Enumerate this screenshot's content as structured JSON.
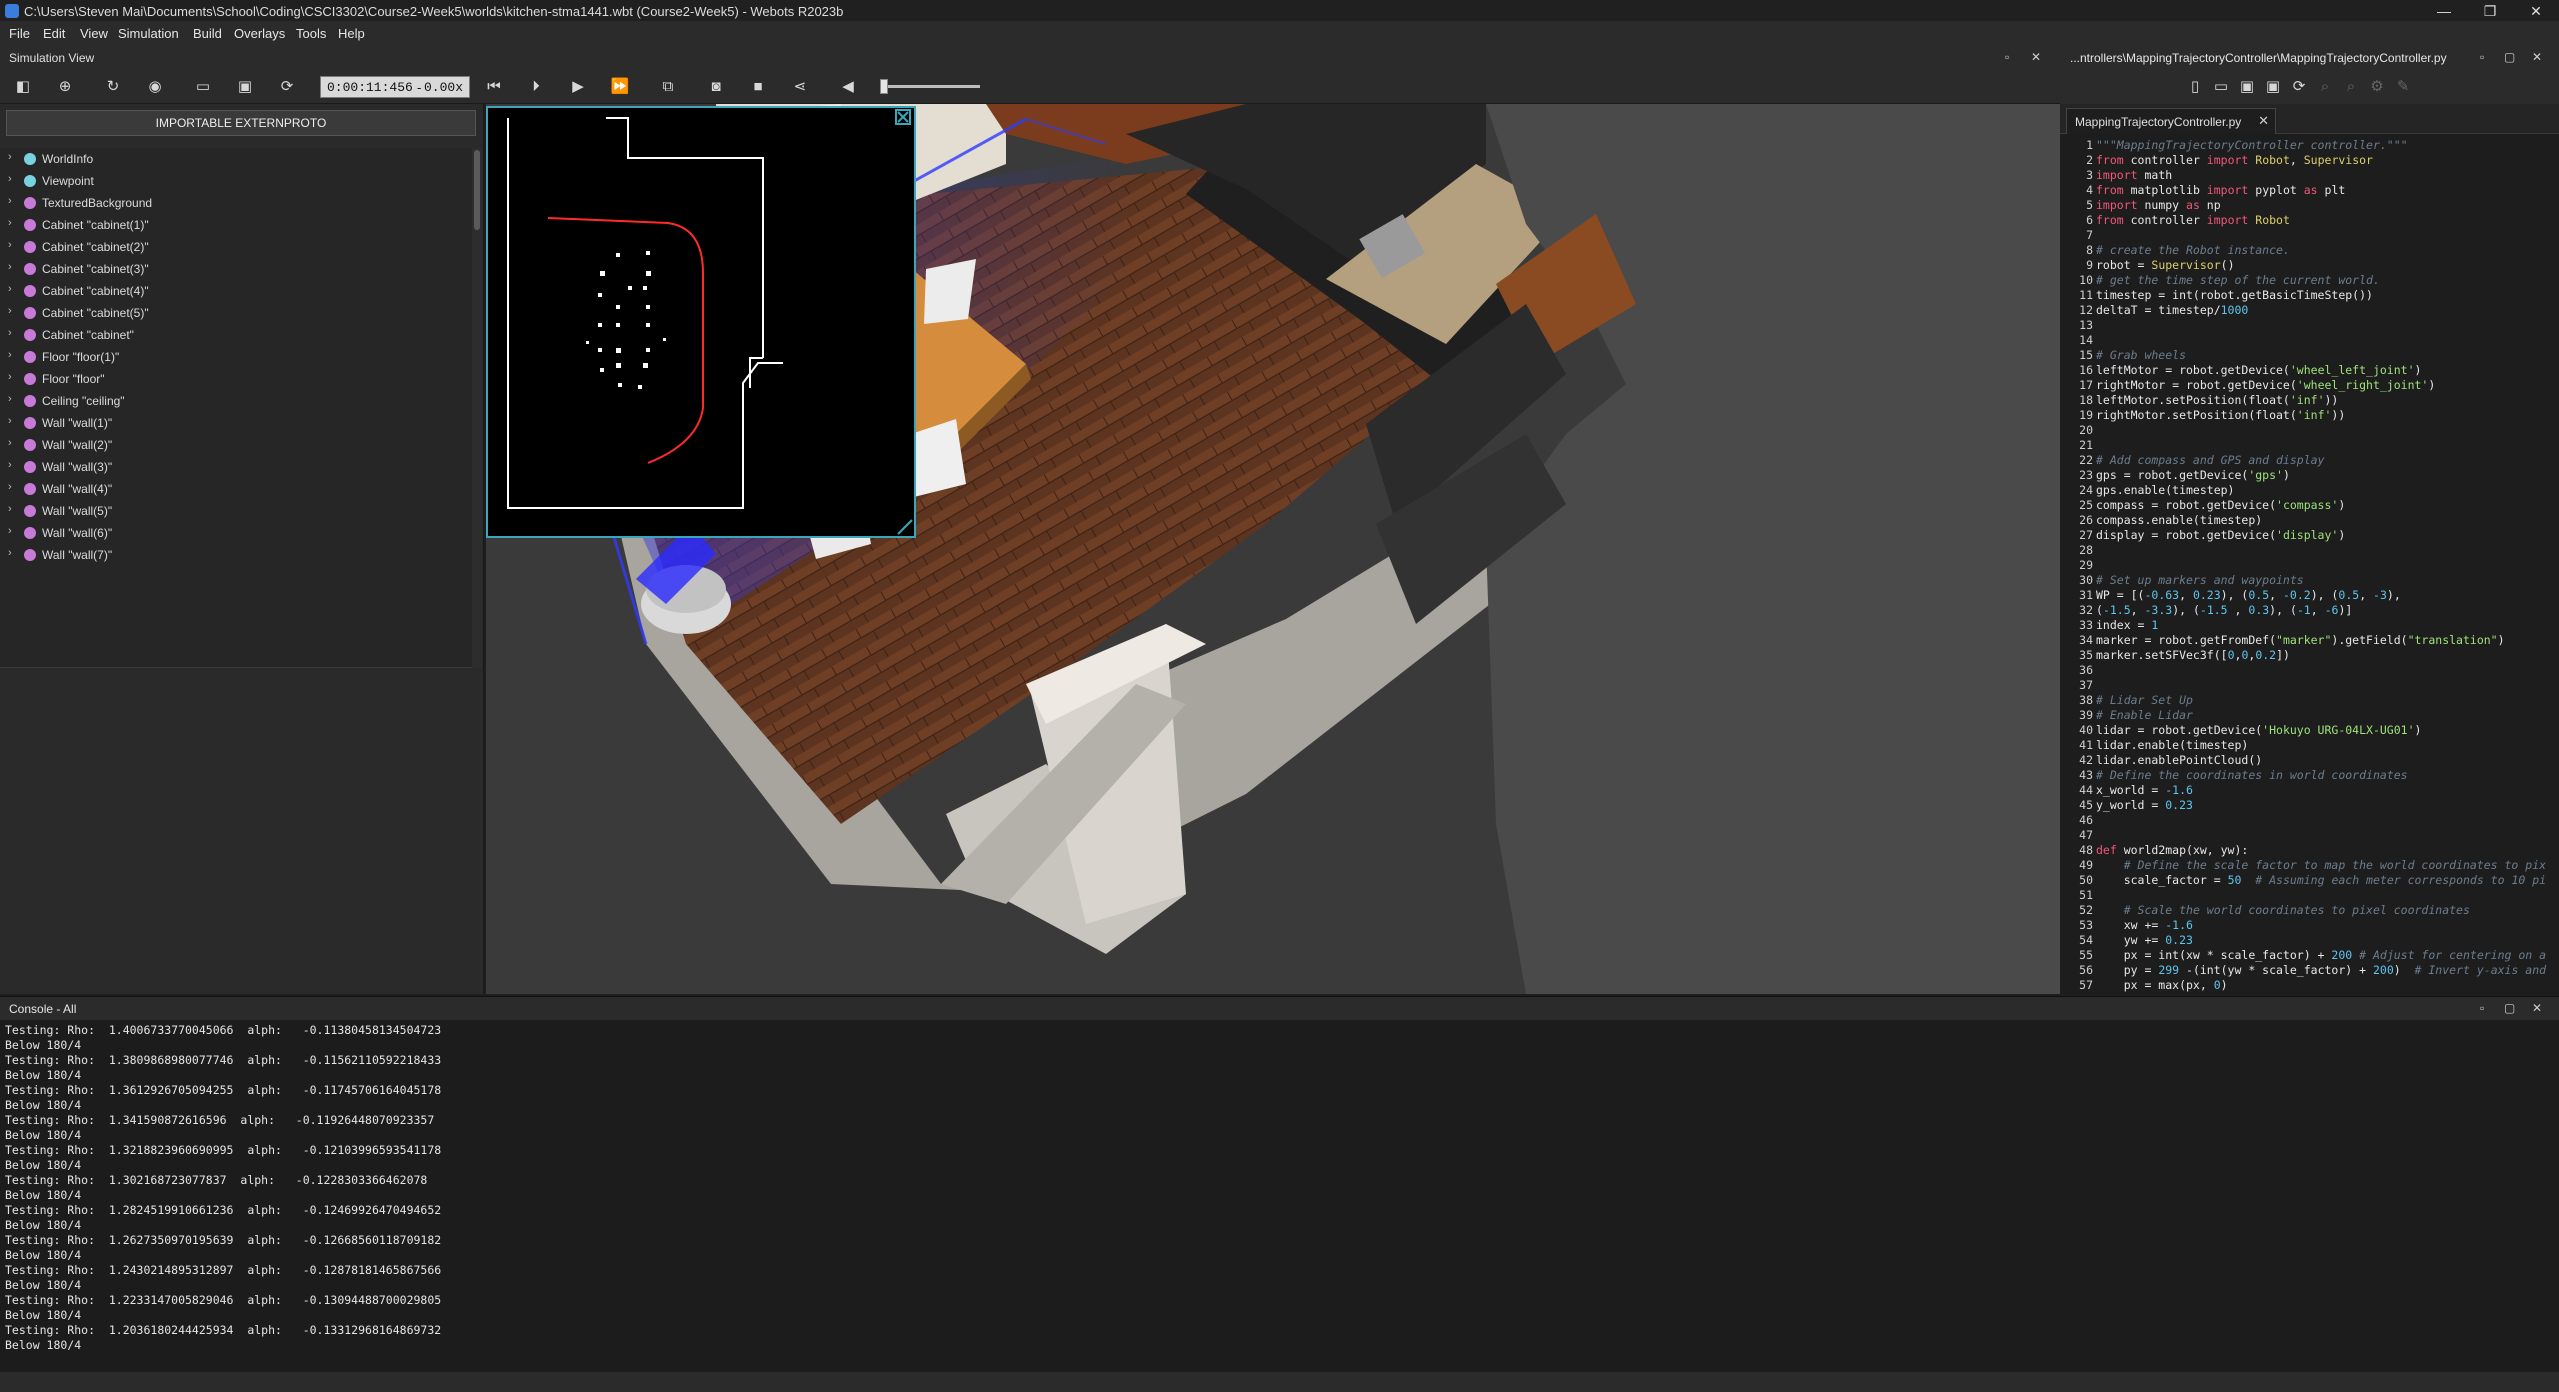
{
  "window": {
    "title": "C:\\Users\\Steven Mai\\Documents\\School\\Coding\\CSCI3302\\Course2-Week5\\worlds\\kitchen-stma1441.wbt (Course2-Week5) - Webots R2023b",
    "controls": {
      "minimize": "—",
      "maximize": "❐",
      "close": "✕"
    }
  },
  "menu": [
    "File",
    "Edit",
    "View",
    "Simulation",
    "Build",
    "Overlays",
    "Tools",
    "Help"
  ],
  "simulation_view": {
    "label": "Simulation View",
    "time": "0:00:11:456",
    "separator": "-",
    "speed": "0.00x"
  },
  "scene_tree": {
    "externproto_button": "IMPORTABLE EXTERNPROTO",
    "items": [
      {
        "label": "WorldInfo",
        "color": "blue"
      },
      {
        "label": "Viewpoint",
        "color": "blue"
      },
      {
        "label": "TexturedBackground",
        "color": "pink"
      },
      {
        "label": "Cabinet \"cabinet(1)\"",
        "color": "pink"
      },
      {
        "label": "Cabinet \"cabinet(2)\"",
        "color": "pink"
      },
      {
        "label": "Cabinet \"cabinet(3)\"",
        "color": "pink"
      },
      {
        "label": "Cabinet \"cabinet(4)\"",
        "color": "pink"
      },
      {
        "label": "Cabinet \"cabinet(5)\"",
        "color": "pink"
      },
      {
        "label": "Cabinet \"cabinet\"",
        "color": "pink"
      },
      {
        "label": "Floor \"floor(1)\"",
        "color": "pink"
      },
      {
        "label": "Floor \"floor\"",
        "color": "pink"
      },
      {
        "label": "Ceiling \"ceiling\"",
        "color": "pink"
      },
      {
        "label": "Wall \"wall(1)\"",
        "color": "pink"
      },
      {
        "label": "Wall \"wall(2)\"",
        "color": "pink"
      },
      {
        "label": "Wall \"wall(3)\"",
        "color": "pink"
      },
      {
        "label": "Wall \"wall(4)\"",
        "color": "pink"
      },
      {
        "label": "Wall \"wall(5)\"",
        "color": "pink"
      },
      {
        "label": "Wall \"wall(6)\"",
        "color": "pink"
      },
      {
        "label": "Wall \"wall(7)\"",
        "color": "pink"
      }
    ]
  },
  "editor": {
    "header": "...ntrollers\\MappingTrajectoryController\\MappingTrajectoryController.py",
    "tab": "MappingTrajectoryController.py",
    "lines": [
      [
        [
          "cm",
          "\"\"\"MappingTrajectoryController controller.\"\"\""
        ]
      ],
      [
        [
          "kw",
          "from"
        ],
        [
          "fn",
          " controller "
        ],
        [
          "kw",
          "import"
        ],
        [
          "cl",
          " Robot"
        ],
        [
          "fn",
          ", "
        ],
        [
          "cl",
          "Supervisor"
        ]
      ],
      [
        [
          "kw",
          "import"
        ],
        [
          "fn",
          " math"
        ]
      ],
      [
        [
          "kw",
          "from"
        ],
        [
          "fn",
          " matplotlib "
        ],
        [
          "kw",
          "import"
        ],
        [
          "fn",
          " pyplot "
        ],
        [
          "kw",
          "as"
        ],
        [
          "fn",
          " plt"
        ]
      ],
      [
        [
          "kw",
          "import"
        ],
        [
          "fn",
          " numpy "
        ],
        [
          "kw",
          "as"
        ],
        [
          "fn",
          " np"
        ]
      ],
      [
        [
          "kw",
          "from"
        ],
        [
          "fn",
          " controller "
        ],
        [
          "kw",
          "import"
        ],
        [
          "cl",
          " Robot"
        ]
      ],
      [
        [
          "fn",
          ""
        ]
      ],
      [
        [
          "cm",
          "# create the Robot instance."
        ]
      ],
      [
        [
          "fn",
          "robot = "
        ],
        [
          "cl",
          "Supervisor"
        ],
        [
          "fn",
          "()"
        ]
      ],
      [
        [
          "cm",
          "# get the time step of the current world."
        ]
      ],
      [
        [
          "fn",
          "timestep = int(robot.getBasicTimeStep())"
        ]
      ],
      [
        [
          "fn",
          "deltaT = timestep/"
        ],
        [
          "nu",
          "1000"
        ]
      ],
      [
        [
          "fn",
          ""
        ]
      ],
      [
        [
          "fn",
          ""
        ]
      ],
      [
        [
          "cm",
          "# Grab wheels"
        ]
      ],
      [
        [
          "fn",
          "leftMotor = robot.getDevice("
        ],
        [
          "st",
          "'wheel_left_joint'"
        ],
        [
          "fn",
          ")"
        ]
      ],
      [
        [
          "fn",
          "rightMotor = robot.getDevice("
        ],
        [
          "st",
          "'wheel_right_joint'"
        ],
        [
          "fn",
          ")"
        ]
      ],
      [
        [
          "fn",
          "leftMotor.setPosition(float("
        ],
        [
          "st",
          "'inf'"
        ],
        [
          "fn",
          "))"
        ]
      ],
      [
        [
          "fn",
          "rightMotor.setPosition(float("
        ],
        [
          "st",
          "'inf'"
        ],
        [
          "fn",
          "))"
        ]
      ],
      [
        [
          "fn",
          ""
        ]
      ],
      [
        [
          "fn",
          ""
        ]
      ],
      [
        [
          "cm",
          "# Add compass and GPS and display"
        ]
      ],
      [
        [
          "fn",
          "gps = robot.getDevice("
        ],
        [
          "st",
          "'gps'"
        ],
        [
          "fn",
          ")"
        ]
      ],
      [
        [
          "fn",
          "gps.enable(timestep)"
        ]
      ],
      [
        [
          "fn",
          "compass = robot.getDevice("
        ],
        [
          "st",
          "'compass'"
        ],
        [
          "fn",
          ")"
        ]
      ],
      [
        [
          "fn",
          "compass.enable(timestep)"
        ]
      ],
      [
        [
          "fn",
          "display = robot.getDevice("
        ],
        [
          "st",
          "'display'"
        ],
        [
          "fn",
          ")"
        ]
      ],
      [
        [
          "fn",
          ""
        ]
      ],
      [
        [
          "fn",
          ""
        ]
      ],
      [
        [
          "cm",
          "# Set up markers and waypoints"
        ]
      ],
      [
        [
          "fn",
          "WP = [("
        ],
        [
          "nu",
          "-0.63"
        ],
        [
          "fn",
          ", "
        ],
        [
          "nu",
          "0.23"
        ],
        [
          "fn",
          "), ("
        ],
        [
          "nu",
          "0.5"
        ],
        [
          "fn",
          ", "
        ],
        [
          "nu",
          "-0.2"
        ],
        [
          "fn",
          "), ("
        ],
        [
          "nu",
          "0.5"
        ],
        [
          "fn",
          ", "
        ],
        [
          "nu",
          "-3"
        ],
        [
          "fn",
          "),"
        ]
      ],
      [
        [
          "fn",
          "("
        ],
        [
          "nu",
          "-1.5"
        ],
        [
          "fn",
          ", "
        ],
        [
          "nu",
          "-3.3"
        ],
        [
          "fn",
          "), ("
        ],
        [
          "nu",
          "-1.5"
        ],
        [
          "fn",
          " , "
        ],
        [
          "nu",
          "0.3"
        ],
        [
          "fn",
          "), ("
        ],
        [
          "nu",
          "-1"
        ],
        [
          "fn",
          ", "
        ],
        [
          "nu",
          "-6"
        ],
        [
          "fn",
          ")]"
        ]
      ],
      [
        [
          "fn",
          "index = "
        ],
        [
          "nu",
          "1"
        ]
      ],
      [
        [
          "fn",
          "marker = robot.getFromDef("
        ],
        [
          "st",
          "\"marker\""
        ],
        [
          "fn",
          ").getField("
        ],
        [
          "st",
          "\"translation\""
        ],
        [
          "fn",
          ")"
        ]
      ],
      [
        [
          "fn",
          "marker.setSFVec3f(["
        ],
        [
          "nu",
          "0"
        ],
        [
          "fn",
          ","
        ],
        [
          "nu",
          "0"
        ],
        [
          "fn",
          ","
        ],
        [
          "nu",
          "0.2"
        ],
        [
          "fn",
          "])"
        ]
      ],
      [
        [
          "fn",
          ""
        ]
      ],
      [
        [
          "fn",
          ""
        ]
      ],
      [
        [
          "cm",
          "# Lidar Set Up"
        ]
      ],
      [
        [
          "cm",
          "# Enable Lidar"
        ]
      ],
      [
        [
          "fn",
          "lidar = robot.getDevice("
        ],
        [
          "st",
          "'Hokuyo URG-04LX-UG01'"
        ],
        [
          "fn",
          ")"
        ]
      ],
      [
        [
          "fn",
          "lidar.enable(timestep)"
        ]
      ],
      [
        [
          "fn",
          "lidar.enablePointCloud()"
        ]
      ],
      [
        [
          "cm",
          "# Define the coordinates in world coordinates"
        ]
      ],
      [
        [
          "fn",
          "x_world = "
        ],
        [
          "nu",
          "-1.6"
        ]
      ],
      [
        [
          "fn",
          "y_world = "
        ],
        [
          "nu",
          "0.23"
        ]
      ],
      [
        [
          "fn",
          ""
        ]
      ],
      [
        [
          "fn",
          ""
        ]
      ],
      [
        [
          "kw",
          "def"
        ],
        [
          "fn",
          " world2map(xw, yw):"
        ]
      ],
      [
        [
          "fn",
          "    "
        ],
        [
          "cm",
          "# Define the scale factor to map the world coordinates to pix"
        ]
      ],
      [
        [
          "fn",
          "    scale_factor = "
        ],
        [
          "nu",
          "50"
        ],
        [
          "fn",
          "  "
        ],
        [
          "cm",
          "# Assuming each meter corresponds to 10 pi"
        ]
      ],
      [
        [
          "fn",
          ""
        ]
      ],
      [
        [
          "fn",
          "    "
        ],
        [
          "cm",
          "# Scale the world coordinates to pixel coordinates"
        ]
      ],
      [
        [
          "fn",
          "    xw += "
        ],
        [
          "nu",
          "-1.6"
        ]
      ],
      [
        [
          "fn",
          "    yw += "
        ],
        [
          "nu",
          "0.23"
        ]
      ],
      [
        [
          "fn",
          "    px = int(xw * scale_factor) + "
        ],
        [
          "nu",
          "200"
        ],
        [
          "fn",
          " "
        ],
        [
          "cm",
          "# Adjust for centering on a"
        ]
      ],
      [
        [
          "fn",
          "    py = "
        ],
        [
          "nu",
          "299"
        ],
        [
          "fn",
          " -(int(yw * scale_factor) + "
        ],
        [
          "nu",
          "200"
        ],
        [
          "fn",
          ")  "
        ],
        [
          "cm",
          "# Invert y-axis and"
        ]
      ],
      [
        [
          "fn",
          "    px = max(px, "
        ],
        [
          "nu",
          "0"
        ],
        [
          "fn",
          ")"
        ]
      ]
    ]
  },
  "console": {
    "label": "Console - All",
    "lines": [
      "Testing: Rho:  1.4006733770045066  alph:   -0.11380458134504723",
      "Below 180/4",
      "Testing: Rho:  1.3809868980077746  alph:   -0.11562110592218433",
      "Below 180/4",
      "Testing: Rho:  1.3612926705094255  alph:   -0.11745706164045178",
      "Below 180/4",
      "Testing: Rho:  1.341590872616596  alph:   -0.11926448070923357",
      "Below 180/4",
      "Testing: Rho:  1.3218823960690995  alph:   -0.12103996593541178",
      "Below 180/4",
      "Testing: Rho:  1.302168723077837  alph:   -0.1228303366462078",
      "Below 180/4",
      "Testing: Rho:  1.2824519910661236  alph:   -0.12469926470494652",
      "Below 180/4",
      "Testing: Rho:  1.2627350970195639  alph:   -0.12668560118709182",
      "Below 180/4",
      "Testing: Rho:  1.2430214895312897  alph:   -0.12878181465867566",
      "Below 180/4",
      "Testing: Rho:  1.2233147005829046  alph:   -0.13094488700029805",
      "Below 180/4",
      "Testing: Rho:  1.2036180244425934  alph:   -0.13312968164869732",
      "Below 180/4"
    ]
  },
  "colors": {
    "accent": "#3aa6b9",
    "lidar": "#2f3bff",
    "floor": "#6b3a22",
    "wall": "#d6d0c6",
    "table": "#d38b3c"
  }
}
